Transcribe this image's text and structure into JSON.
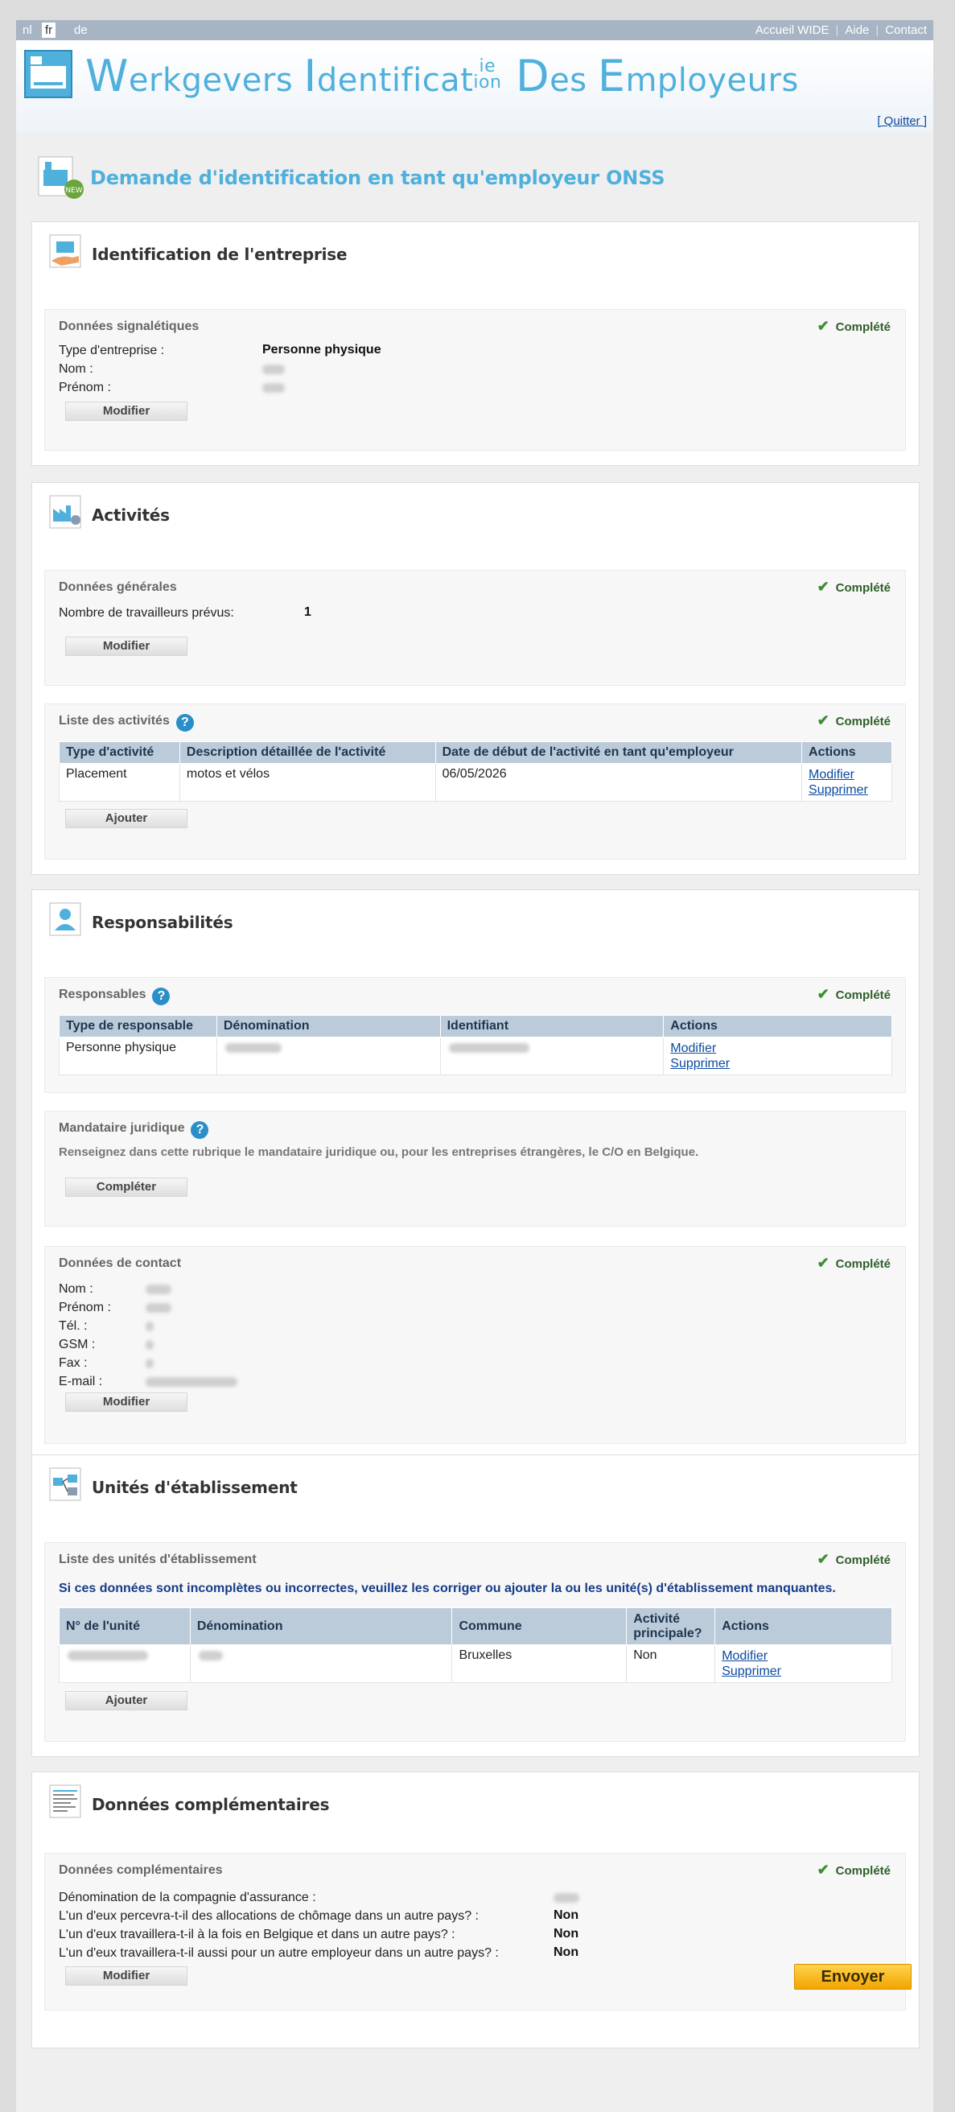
{
  "topbar": {
    "langs": [
      "nl",
      "fr",
      "de"
    ],
    "links": [
      "Accueil WIDE",
      "Aide",
      "Contact"
    ]
  },
  "banner": {
    "title_w": "W",
    "title_erkgevers": "erkgevers ",
    "title_i": "I",
    "title_dentificat": "dentificat",
    "title_ie": "ie",
    "title_ion": "ion",
    "title_d": " D",
    "title_es": "es ",
    "title_e": "E",
    "title_mployeurs": "mployeurs",
    "quit": "[ Quitter ]"
  },
  "page": {
    "title": "Demande d'identification en tant qu'employeur ONSS",
    "new_badge": "NEW",
    "send": "Envoyer"
  },
  "complete_label": "Complété",
  "identification": {
    "title": "Identification de l'entreprise",
    "sub_title": "Données signalétiques",
    "type_label": "Type d'entreprise :",
    "type_value": "Personne physique",
    "nom_label": "Nom :",
    "prenom_label": "Prénom :",
    "button": "Modifier"
  },
  "activites": {
    "title": "Activités",
    "general_title": "Données générales",
    "workers_label": "Nombre de travailleurs prévus:",
    "workers_value": "1",
    "general_button": "Modifier",
    "list_title": "Liste des activités",
    "columns": [
      "Type d'activité",
      "Description détaillée de l'activité",
      "Date de début de l'activité en tant qu'employeur",
      "Actions"
    ],
    "rows": [
      {
        "type": "Placement",
        "description": "motos et vélos",
        "date": "06/05/2026",
        "modify": "Modifier",
        "delete": "Supprimer"
      }
    ],
    "add_button": "Ajouter"
  },
  "responsabilites": {
    "title": "Responsabilités",
    "resp_title": "Responsables",
    "columns": [
      "Type de responsable",
      "Dénomination",
      "Identifiant",
      "Actions"
    ],
    "rows": [
      {
        "type": "Personne physique",
        "modify": "Modifier",
        "delete": "Supprimer"
      }
    ],
    "mandataire_title": "Mandataire juridique",
    "mandataire_note": "Renseignez dans cette rubrique le mandataire juridique ou, pour les entreprises étrangères, le C/O en Belgique.",
    "mandataire_button": "Compléter",
    "contact_title": "Données de contact",
    "contact_labels": [
      "Nom :",
      "Prénom :",
      "Tél. :",
      "GSM :",
      "Fax :",
      "E-mail :"
    ],
    "contact_button": "Modifier"
  },
  "unites": {
    "title": "Unités d'établissement",
    "list_title": "Liste des unités d'établissement",
    "warning": "Si ces données sont incomplètes ou incorrectes, veuillez les corriger ou ajouter la ou les unité(s) d'établissement manquantes.",
    "columns": [
      "N° de l'unité",
      "Dénomination",
      "Commune",
      "Activité principale?",
      "Actions"
    ],
    "rows": [
      {
        "commune": "Bruxelles",
        "principal": "Non",
        "modify": "Modifier",
        "delete": "Supprimer"
      }
    ],
    "add_button": "Ajouter"
  },
  "complementaires": {
    "title": "Données complémentaires",
    "sub_title": "Données complémentaires",
    "q1": "Dénomination de la compagnie d'assurance :",
    "q2": "L'un d'eux percevra-t-il des allocations de chômage dans un autre pays? :",
    "q2_value": "Non",
    "q3": "L'un d'eux travaillera-t-il à la fois en Belgique et dans un autre pays? :",
    "q3_value": "Non",
    "q4": "L'un d'eux travaillera-t-il aussi pour un autre employeur dans un autre pays? :",
    "q4_value": "Non",
    "button": "Modifier"
  },
  "colors": {
    "accent": "#4fb0dc",
    "header_bar": "#a7b4c4",
    "table_header": "#bccbd9",
    "send_button": "#f2a400"
  },
  "icons": [
    "document-icon",
    "new-badge-icon",
    "hand-card-icon",
    "factory-icon",
    "person-icon",
    "units-icon",
    "data-doc-icon",
    "check-icon",
    "help-icon"
  ]
}
